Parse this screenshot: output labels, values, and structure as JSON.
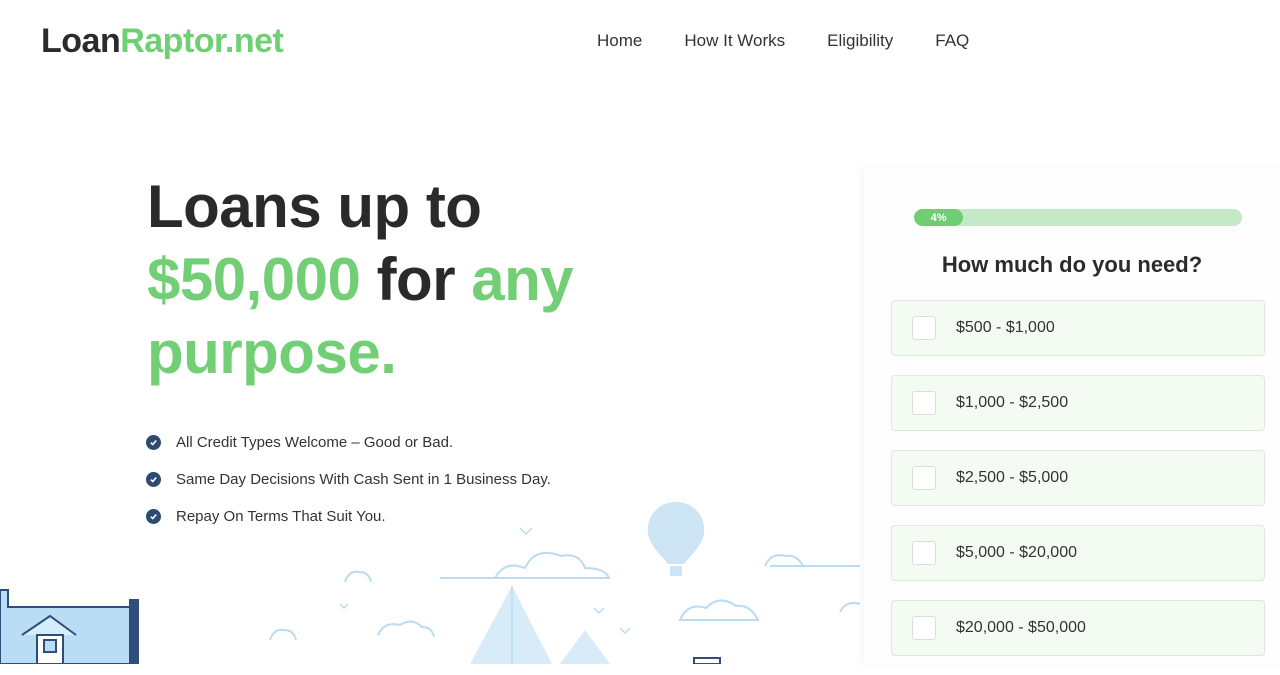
{
  "brand": {
    "part1": "Loan",
    "part2": "Raptor.net"
  },
  "nav": {
    "home": "Home",
    "how": "How It Works",
    "eligibility": "Eligibility",
    "faq": "FAQ"
  },
  "hero": {
    "line1": "Loans up to",
    "amount": "$50,000",
    "for": "for",
    "any": "any",
    "purpose": "purpose."
  },
  "bullets": [
    "All Credit Types Welcome – Good or Bad.",
    "Same Day Decisions With Cash Sent in 1 Business Day.",
    "Repay On Terms That Suit You."
  ],
  "form": {
    "progress_label": "4%",
    "progress_value": 4,
    "question": "How much do you need?",
    "options": [
      "$500 - $1,000",
      "$1,000 - $2,500",
      "$2,500 - $5,000",
      "$5,000 - $20,000",
      "$20,000 - $50,000"
    ]
  },
  "colors": {
    "accent": "#6fcf73",
    "dark": "#2b2b2b",
    "check": "#2d4a73",
    "option_bg": "#f4fbf3"
  },
  "icons": {
    "check": "check-circle-icon",
    "checkbox": "checkbox-icon"
  }
}
